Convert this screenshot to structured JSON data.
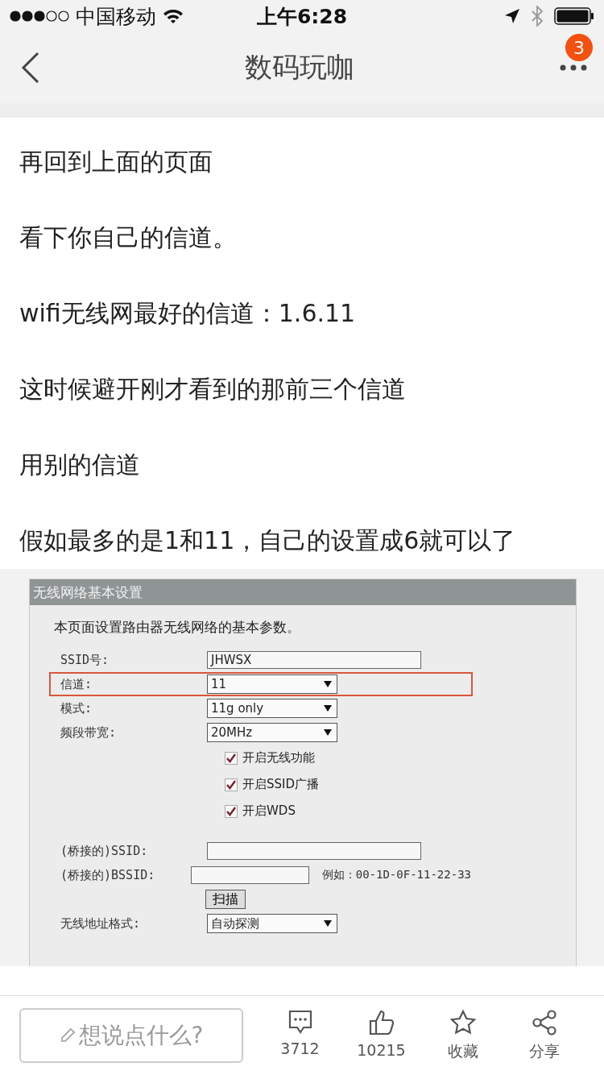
{
  "status_bar": {
    "carrier": "中国移动",
    "time": "上午6:28"
  },
  "nav": {
    "title": "数码玩咖",
    "badge": "3"
  },
  "paragraphs": [
    "再回到上面的页面",
    "看下你自己的信道。",
    "wifi无线网最好的信道：1.6.11",
    "这时候避开刚才看到的那前三个信道",
    "用别的信道",
    "假如最多的是1和11，自己的设置成6就可以了"
  ],
  "router_panel": {
    "title": "无线网络基本设置",
    "intro": "本页面设置路由器无线网络的基本参数。",
    "rows": [
      {
        "kind": "text",
        "label": "SSID号:",
        "value": "JHWSX",
        "highlighted": false
      },
      {
        "kind": "select",
        "label": "信道:",
        "value": "11",
        "highlighted": true
      },
      {
        "kind": "select",
        "label": "模式:",
        "value": "11g only",
        "highlighted": false
      },
      {
        "kind": "select",
        "label": "频段带宽:",
        "value": "20MHz",
        "highlighted": false
      },
      {
        "kind": "checkbox",
        "label": "开启无线功能",
        "checked": true
      },
      {
        "kind": "checkbox",
        "label": "开启SSID广播",
        "checked": true
      },
      {
        "kind": "checkbox",
        "label": "开启WDS",
        "checked": true
      },
      {
        "kind": "spacer"
      },
      {
        "kind": "text",
        "label": "(桥接的)SSID:",
        "highlighted": false
      },
      {
        "kind": "text",
        "label": "(桥接的)BSSID:",
        "highlighted": false,
        "note": "例如：00-1D-0F-11-22-33"
      },
      {
        "kind": "button",
        "label": "扫描"
      },
      {
        "kind": "select",
        "label": "无线地址格式:",
        "value": "自动探测",
        "highlighted": false
      }
    ]
  },
  "bottom_bar": {
    "placeholder": "想说点什么?",
    "actions": [
      {
        "kind": "comment",
        "label": "3712"
      },
      {
        "kind": "like",
        "label": "10215"
      },
      {
        "kind": "favorite",
        "label": "收藏"
      },
      {
        "kind": "share",
        "label": "分享"
      }
    ]
  }
}
